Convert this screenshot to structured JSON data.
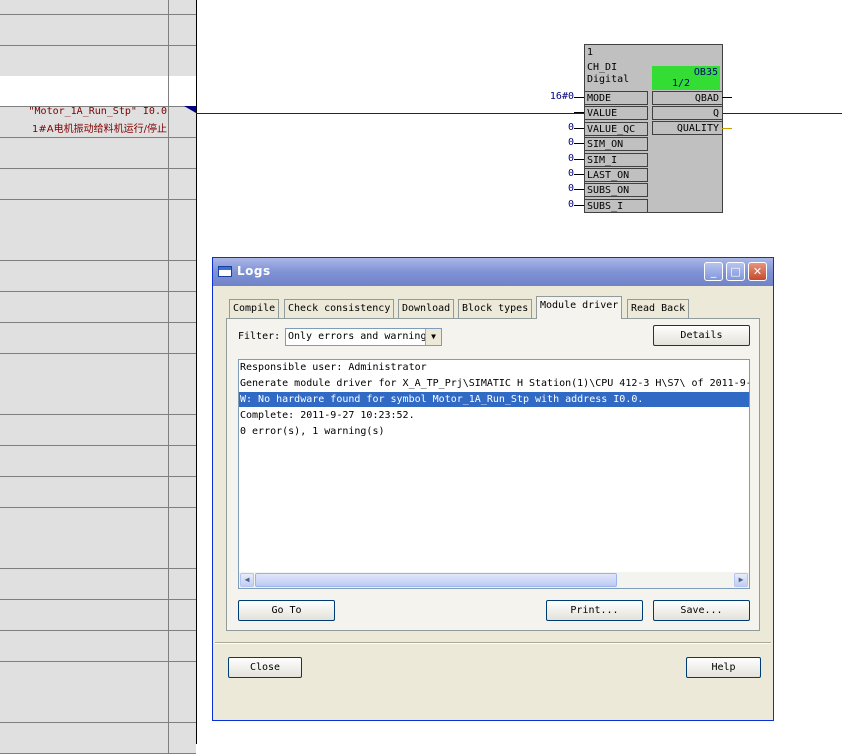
{
  "left_margin": {
    "signal_name": "\"Motor_1A_Run_Stp\" I0.0",
    "signal_comment": "1#A电机振动给料机运行/停止"
  },
  "block": {
    "number": "1",
    "type": "CH_DI",
    "description": "Digital",
    "ob_label": "OB35",
    "ob_fraction": "1/2",
    "inputs": [
      {
        "name": "MODE",
        "value": "16#0"
      },
      {
        "name": "VALUE",
        "value": ""
      },
      {
        "name": "VALUE_QC",
        "value": "0"
      },
      {
        "name": "SIM_ON",
        "value": "0"
      },
      {
        "name": "SIM_I",
        "value": "0"
      },
      {
        "name": "LAST_ON",
        "value": "0"
      },
      {
        "name": "SUBS_ON",
        "value": "0"
      },
      {
        "name": "SUBS_I",
        "value": "0"
      }
    ],
    "outputs": [
      "QBAD",
      "Q",
      "QUALITY"
    ]
  },
  "dialog": {
    "title": "Logs",
    "tabs": [
      "Compile",
      "Check consistency",
      "Download",
      "Block types",
      "Module driver",
      "Read Back"
    ],
    "active_tab": "Module driver",
    "filter_label": "Filter:",
    "filter_value": "Only errors and warnings",
    "details_button": "Details",
    "log_lines": [
      "Responsible user: Administrator",
      "Generate module driver for X_A_TP_Prj\\SIMATIC H Station(1)\\CPU 412-3 H\\S7\\ of 2011-9-",
      "W:   No hardware found for symbol Motor_1A_Run_Stp with address I0.0.",
      "Complete: 2011-9-27 10:23:52.",
      "0 error(s), 1 warning(s)"
    ],
    "goto_button": "Go To",
    "print_button": "Print...",
    "save_button": "Save...",
    "close_button": "Close",
    "help_button": "Help"
  },
  "colors": {
    "titlebar": "#7f92d6",
    "highlight": "#316ac5",
    "ob_green": "#33dd33",
    "wire": "#800000"
  }
}
